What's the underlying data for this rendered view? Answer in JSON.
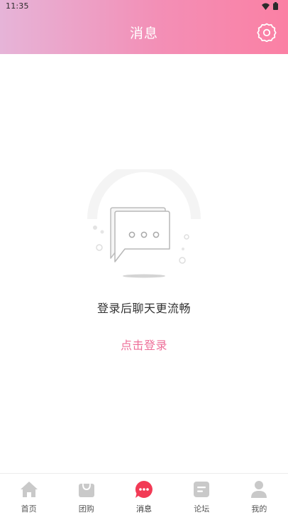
{
  "status_bar": {
    "time": "11:35"
  },
  "header": {
    "title": "消息"
  },
  "empty_state": {
    "message": "登录后聊天更流畅",
    "login_link": "点击登录"
  },
  "tabbar": {
    "items": [
      {
        "label": "首页",
        "icon": "home-icon",
        "active": false
      },
      {
        "label": "团购",
        "icon": "shopping-bag-icon",
        "active": false
      },
      {
        "label": "消息",
        "icon": "chat-bubble-icon",
        "active": true
      },
      {
        "label": "论坛",
        "icon": "forum-icon",
        "active": false
      },
      {
        "label": "我的",
        "icon": "user-icon",
        "active": false
      }
    ]
  },
  "colors": {
    "header_gradient_start": "#e6b4d8",
    "header_gradient_end": "#fb80a4",
    "accent": "#ee6f99",
    "active_tab": "#f23a55",
    "inactive_tab_icon": "#c9c9c9"
  }
}
